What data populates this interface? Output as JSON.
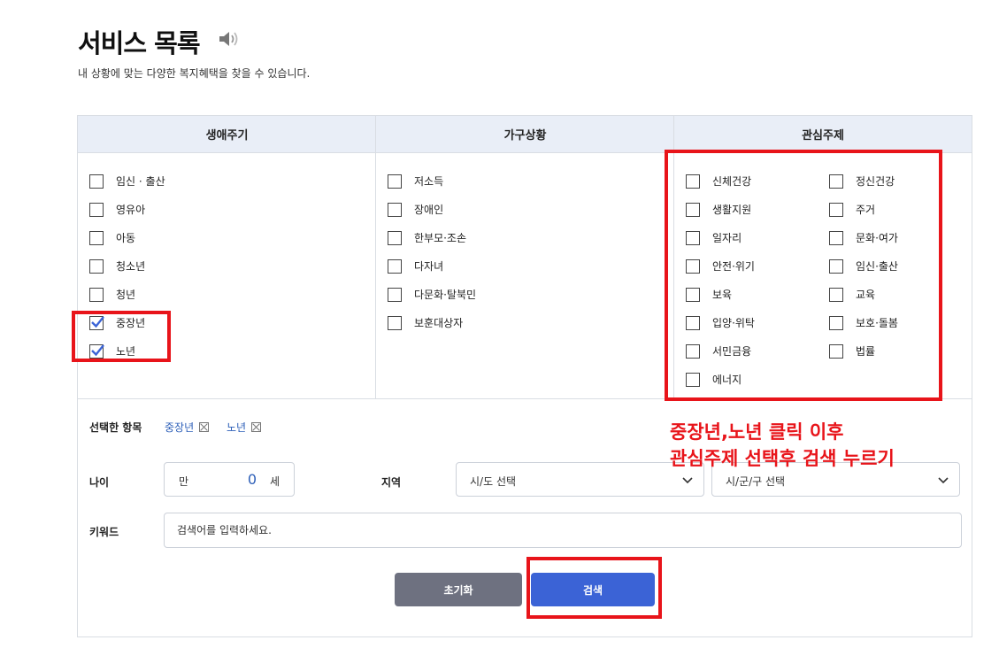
{
  "header": {
    "title": "서비스 목록",
    "subtitle": "내 상황에 맞는 다양한 복지혜택을 찾을 수 있습니다."
  },
  "columns": {
    "life_cycle": {
      "title": "생애주기",
      "items": [
        {
          "label": "임신 · 출산",
          "checked": false
        },
        {
          "label": "영유아",
          "checked": false
        },
        {
          "label": "아동",
          "checked": false
        },
        {
          "label": "청소년",
          "checked": false
        },
        {
          "label": "청년",
          "checked": false
        },
        {
          "label": "중장년",
          "checked": true
        },
        {
          "label": "노년",
          "checked": true
        }
      ]
    },
    "household": {
      "title": "가구상황",
      "items": [
        {
          "label": "저소득",
          "checked": false
        },
        {
          "label": "장애인",
          "checked": false
        },
        {
          "label": "한부모·조손",
          "checked": false
        },
        {
          "label": "다자녀",
          "checked": false
        },
        {
          "label": "다문화·탈북민",
          "checked": false
        },
        {
          "label": "보훈대상자",
          "checked": false
        }
      ]
    },
    "interest": {
      "title": "관심주제",
      "left": [
        {
          "label": "신체건강",
          "checked": false
        },
        {
          "label": "생활지원",
          "checked": false
        },
        {
          "label": "일자리",
          "checked": false
        },
        {
          "label": "안전·위기",
          "checked": false
        },
        {
          "label": "보육",
          "checked": false
        },
        {
          "label": "입양·위탁",
          "checked": false
        },
        {
          "label": "서민금융",
          "checked": false
        },
        {
          "label": "에너지",
          "checked": false
        }
      ],
      "right": [
        {
          "label": "정신건강",
          "checked": false
        },
        {
          "label": "주거",
          "checked": false
        },
        {
          "label": "문화·여가",
          "checked": false
        },
        {
          "label": "임신·출산",
          "checked": false
        },
        {
          "label": "교육",
          "checked": false
        },
        {
          "label": "보호·돌봄",
          "checked": false
        },
        {
          "label": "법률",
          "checked": false
        }
      ]
    }
  },
  "filters": {
    "selected_label": "선택한 항목",
    "selected": [
      "중장년",
      "노년"
    ],
    "age_label": "나이",
    "age_prefix": "만",
    "age_value": "0",
    "age_suffix": "세",
    "region_label": "지역",
    "region_sido": "시/도 선택",
    "region_sigungu": "시/군/구 선택",
    "keyword_label": "키워드",
    "keyword_placeholder": "검색어를 입력하세요."
  },
  "buttons": {
    "reset": "초기화",
    "search": "검색"
  },
  "annotation": {
    "line1": "중장년,노년 클릭 이후",
    "line2": "관심주제 선택후 검색 누르기",
    "color": "#e8141a"
  },
  "colors": {
    "accent": "#3b63d6",
    "header_bg": "#e9eef7",
    "reset_bg": "#6e7180",
    "chip_text": "#2d5fb8"
  },
  "icons": {
    "speaker": "speaker-icon",
    "check": "check-icon",
    "chevron": "chevron-down-icon",
    "remove": "close-icon"
  }
}
